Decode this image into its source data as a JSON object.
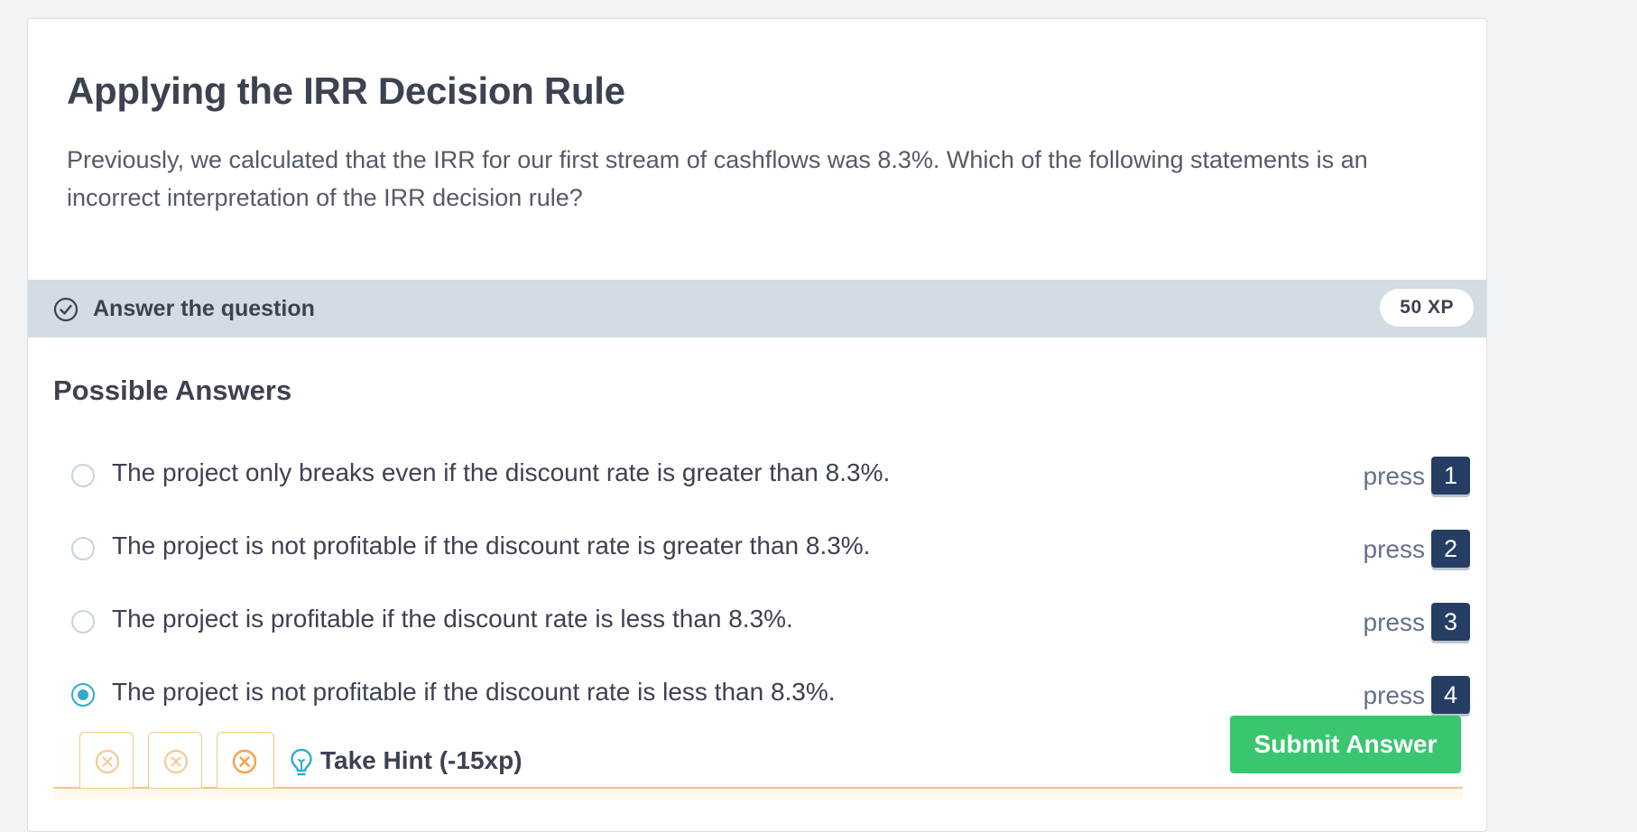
{
  "exercise": {
    "title": "Applying the IRR Decision Rule",
    "question": "Previously, we calculated that the IRR for our first stream of cashflows was 8.3%. Which of the following statements is an incorrect interpretation of the IRR decision rule?"
  },
  "answer_bar": {
    "icon": "check-circle-icon",
    "label": "Answer the question",
    "xp": "50 XP"
  },
  "possible_answers": {
    "title": "Possible Answers",
    "press_label": "press",
    "options": [
      {
        "text": "The project only breaks even if the discount rate is greater than 8.3%.",
        "key": "1",
        "selected": false
      },
      {
        "text": "The project is not profitable if the discount rate is greater than 8.3%.",
        "key": "2",
        "selected": false
      },
      {
        "text": "The project is profitable if the discount rate is less than 8.3%.",
        "key": "3",
        "selected": false
      },
      {
        "text": "The project is not profitable if the discount rate is less than 8.3%.",
        "key": "4",
        "selected": true
      }
    ]
  },
  "footer": {
    "hint_label": "Take Hint (-15xp)",
    "submit_label": "Submit Answer"
  },
  "colors": {
    "accent_blue": "#33aacc",
    "key_badge": "#263e63",
    "submit_green": "#3ac66f",
    "hint_orange": "#f5a14d",
    "answer_bar": "#d1dce3"
  }
}
